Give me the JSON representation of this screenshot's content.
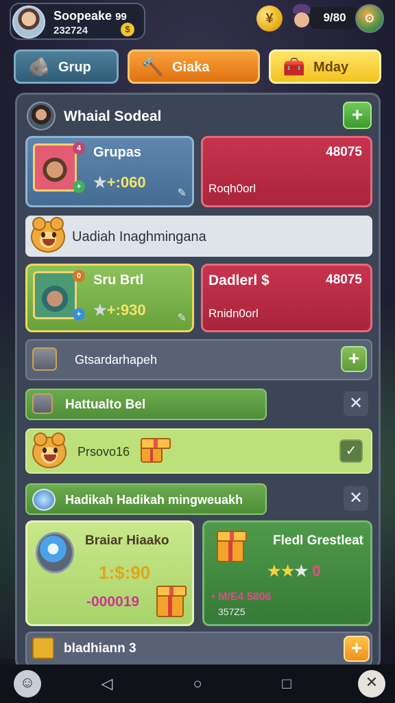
{
  "profile": {
    "name": "Soopeake",
    "level": "99",
    "code": "232724",
    "coin_symbol": "$"
  },
  "hud": {
    "score": "9/80",
    "coin_symbol": "¥"
  },
  "tabs": [
    {
      "label": "Grup",
      "icon": "rock-icon"
    },
    {
      "label": "Giaka",
      "icon": "hammer-icon"
    },
    {
      "label": "Mday",
      "icon": "chest-icon"
    }
  ],
  "section": {
    "title": "Whaial Sodeal",
    "add_label": "+"
  },
  "card1": {
    "name": "Grupas",
    "stars": "+:060",
    "badge": "4"
  },
  "red1": {
    "value": "48075",
    "label": "Roqh0orl"
  },
  "banner1": {
    "text": "Uadiah Inaghmingana"
  },
  "card2": {
    "name": "Sru Brtl",
    "stars": "+:930",
    "badge": "0"
  },
  "red2": {
    "title": "Dadlerl $",
    "value": "48075",
    "label": "Rnidn0orl"
  },
  "row1": {
    "text": "Gtsardarhapeh",
    "add_label": "+"
  },
  "row2": {
    "text": "Hattualto Bel",
    "close_label": "✕"
  },
  "row3": {
    "text": "Prsovo16",
    "check_label": "✓"
  },
  "row4": {
    "text": "Hadikah Hadikah mingweuakh",
    "close_label": "✕"
  },
  "reward_left": {
    "title": "Braiar Hiaako",
    "price": "1:$:90",
    "amount": "-000019"
  },
  "reward_right": {
    "title": "Fledl Grestleat",
    "stars": "0",
    "line1": "M/E4 5806",
    "line2": "357Z5"
  },
  "bottom_row": {
    "text": "bladhiann 3",
    "add_label": "+"
  },
  "colors": {
    "accent_orange": "#f59326",
    "accent_yellow": "#f6d13a",
    "panel": "#3c4556",
    "red_card": "#b82a42",
    "green_card": "#7ab64a"
  }
}
